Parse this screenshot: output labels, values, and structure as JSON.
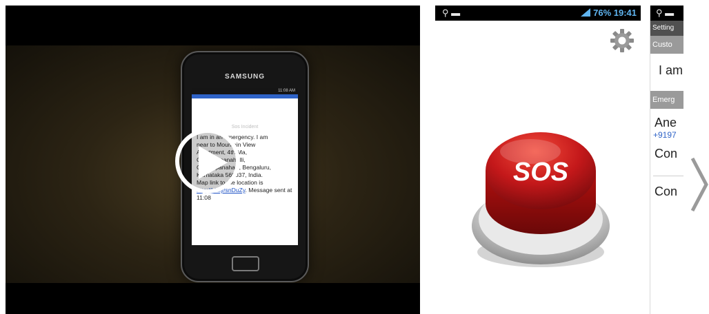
{
  "video": {
    "phone_brand": "SAMSUNG",
    "phone_status_time": "11:08 AM",
    "screen_header": "Sos Incident",
    "message_lines": [
      "I am in an emergency. I am",
      "near to Mountain View",
      "Apartment, 4th Ma,",
      "Chokkappanahalli,",
      "Chinnapanahalli, Bengaluru,",
      "Karnataka 560037, India.",
      "Map link to the location is"
    ],
    "message_link": "http://bit.ly/snDuZy",
    "message_end": ". Message sent at 11:08",
    "play_icon": "play-circle-icon"
  },
  "shot2": {
    "status_left": "⚲ ▬",
    "status_right": "76% 19:41",
    "gear_icon": "gear-icon",
    "sos_label": "SOS"
  },
  "shot3": {
    "status_left": "⚲ ▬",
    "appbar_title": "Setting",
    "section1": "Custo",
    "row1": "I am",
    "section2": "Emerg",
    "row2": "Ane",
    "row2_sub": "+9197",
    "row3": "Con",
    "row4": "Con"
  },
  "navigation": {
    "next_icon": "chevron-right-icon"
  },
  "colors": {
    "sos_red": "#c4181a",
    "gray_section": "#9a9a9a",
    "appbar": "#505050",
    "link_blue": "#2f63c7"
  }
}
